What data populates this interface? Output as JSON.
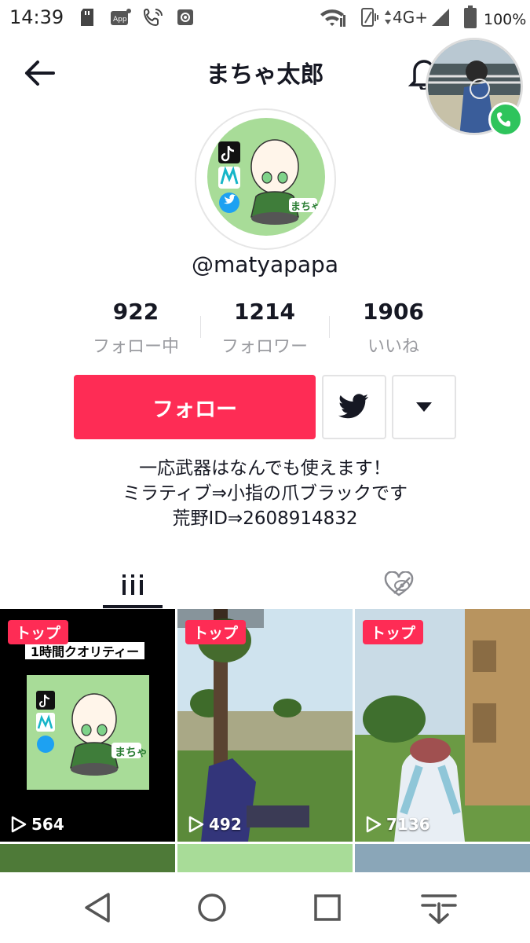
{
  "status": {
    "time": "14:39",
    "network": "4G+",
    "battery": "100%",
    "icons": [
      "sd-card-icon",
      "app-notification-icon",
      "wifi-calling-icon",
      "settings-icon",
      "wifi-icon",
      "vibrate-icon",
      "signal-icon",
      "battery-icon"
    ]
  },
  "header": {
    "title": "まちゃ太郎",
    "back_icon": "arrow-left-icon",
    "bell_icon": "bell-icon"
  },
  "profile": {
    "username": "@matyapapa",
    "avatar_caption": "まちゃ"
  },
  "stats": [
    {
      "value": "922",
      "label": "フォロー中"
    },
    {
      "value": "1214",
      "label": "フォロワー"
    },
    {
      "value": "1906",
      "label": "いいね"
    }
  ],
  "actions": {
    "follow_label": "フォロー",
    "twitter_icon": "twitter-icon",
    "more_icon": "caret-down-icon"
  },
  "bio": {
    "line1": "一応武器はなんでも使えます！",
    "line2": "ミラティブ⇒小指の爪ブラックです",
    "line3": "荒野ID⇒2608914832"
  },
  "tabs": [
    {
      "name": "videos",
      "icon": "grid-icon",
      "active": true
    },
    {
      "name": "liked",
      "icon": "hidden-likes-icon",
      "active": false
    }
  ],
  "videos": [
    {
      "badge": "トップ",
      "views": "564",
      "caption": "1時間クオリティー",
      "thumb_caption": "まちゃ"
    },
    {
      "badge": "トップ",
      "views": "492"
    },
    {
      "badge": "トップ",
      "views": "7136"
    }
  ],
  "colors": {
    "accent": "#fe2c55",
    "text": "#161823",
    "secondary_text": "#9a9ba0",
    "avatar_bg": "#a8dc98"
  },
  "navbar": {
    "icons": [
      "back-triangle-icon",
      "home-circle-icon",
      "recents-square-icon",
      "notification-pull-icon"
    ]
  }
}
